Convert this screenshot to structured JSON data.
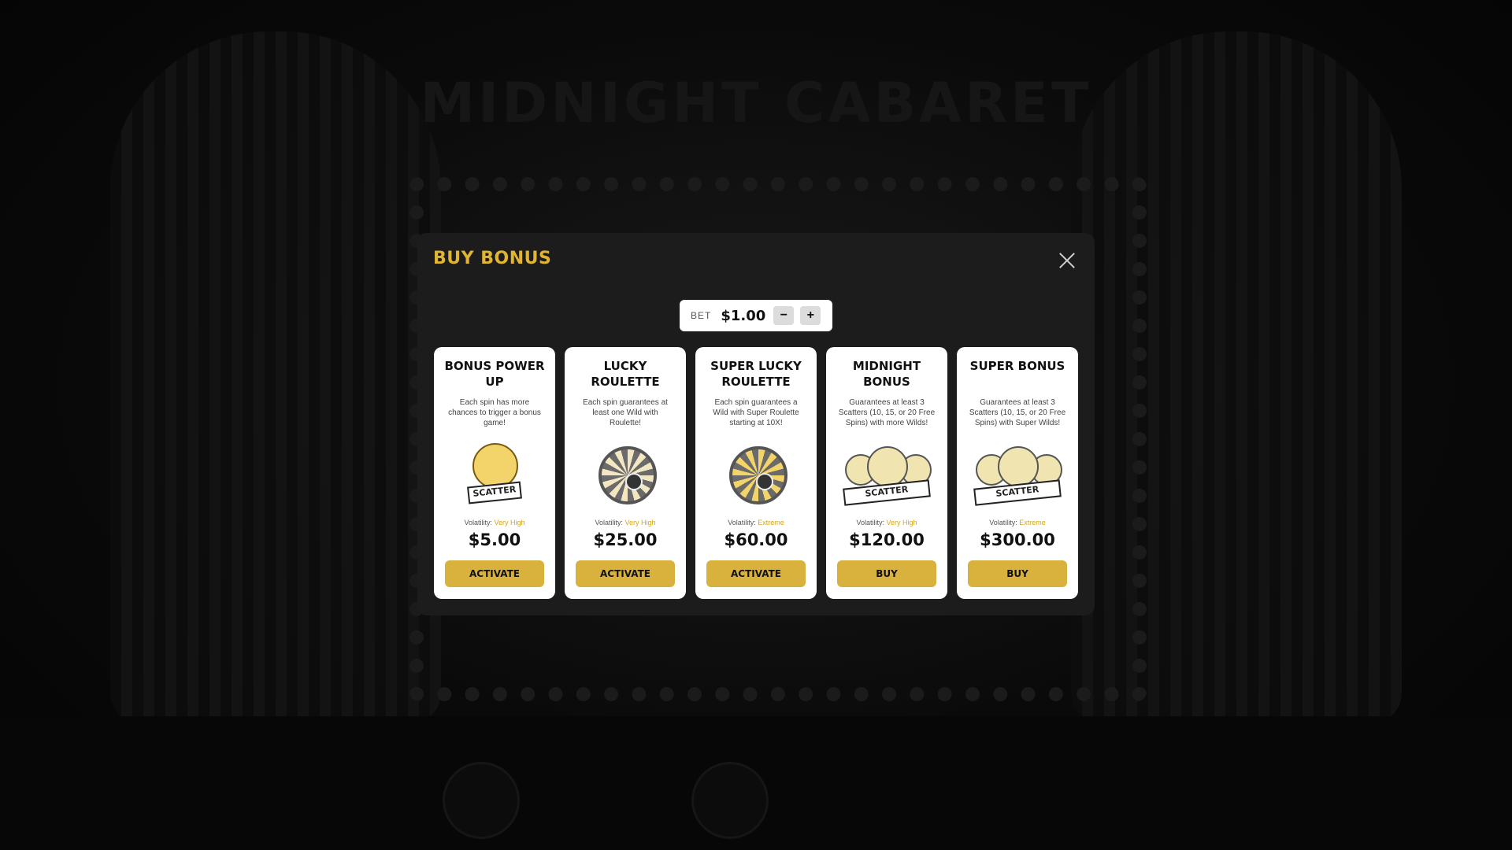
{
  "background": {
    "game_title": "MIDNIGHT CABARET"
  },
  "modal": {
    "title": "BUY BONUS",
    "bet": {
      "label": "BET",
      "value": "$1.00",
      "minus": "−",
      "plus": "+"
    },
    "cards": [
      {
        "title": "Bonus Power Up",
        "description": "Each spin has more chances to trigger a bonus game!",
        "art": "scatter-moon-icon",
        "art_text": "SCATTER",
        "volatility_label": "Volatility:",
        "volatility": "Very High",
        "price": "$5.00",
        "button": "ACTIVATE"
      },
      {
        "title": "Lucky Roulette",
        "description": "Each spin guarantees at least one Wild with Roulette!",
        "art": "roulette-wheel-icon",
        "volatility_label": "Volatility:",
        "volatility": "Very High",
        "price": "$25.00",
        "button": "ACTIVATE"
      },
      {
        "title": "Super Lucky Roulette",
        "description": "Each spin guarantees a Wild with Super Roulette starting at 10X!",
        "art": "super-roulette-wheel-icon",
        "volatility_label": "Volatility:",
        "volatility": "Extreme",
        "price": "$60.00",
        "button": "ACTIVATE"
      },
      {
        "title": "Midnight Bonus",
        "description": "Guarantees at least 3 Scatters (10, 15, or 20 Free Spins) with more Wilds!",
        "art": "three-scatters-icon",
        "art_text": "SCATTER",
        "volatility_label": "Volatility:",
        "volatility": "Very High",
        "price": "$120.00",
        "button": "BUY"
      },
      {
        "title": "Super Bonus",
        "description": "Guarantees at least 3 Scatters (10, 15, or 20 Free Spins) with Super Wilds!",
        "art": "three-super-scatters-icon",
        "art_text": "SCATTER",
        "volatility_label": "Volatility:",
        "volatility": "Extreme",
        "price": "$300.00",
        "button": "BUY"
      }
    ]
  },
  "colors": {
    "accent": "#e1b531",
    "button": "#d9b23d",
    "modal_bg": "#1c1c1c",
    "volatility": "#d4a520"
  }
}
